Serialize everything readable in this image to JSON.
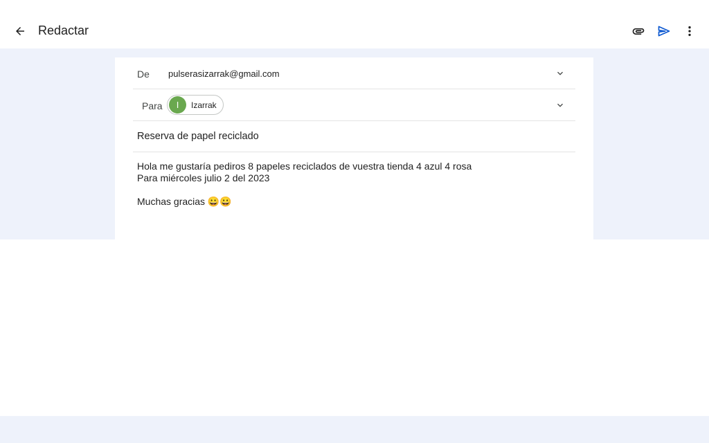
{
  "header": {
    "title": "Redactar",
    "back_icon": "arrow-back-icon",
    "attach_icon": "paperclip-icon",
    "send_icon": "send-icon",
    "more_icon": "more-vert-icon",
    "send_color": "#0b57d0"
  },
  "compose": {
    "from_label": "De",
    "from_value": "pulserasizarrak@gmail.com",
    "to_label": "Para",
    "recipient": {
      "initial": "I",
      "name": "Izarrak",
      "avatar_color": "#6aa84f"
    },
    "subject": "Reserva de papel reciclado",
    "body_lines": [
      "Hola me gustaría pediros 8 papeles reciclados de vuestra tienda 4 azul 4 rosa",
      "Para miércoles julio 2 del 2023",
      "",
      "Muchas gracias 😀😀"
    ]
  },
  "colors": {
    "background_tint": "#eef2fb",
    "surface": "#ffffff"
  }
}
